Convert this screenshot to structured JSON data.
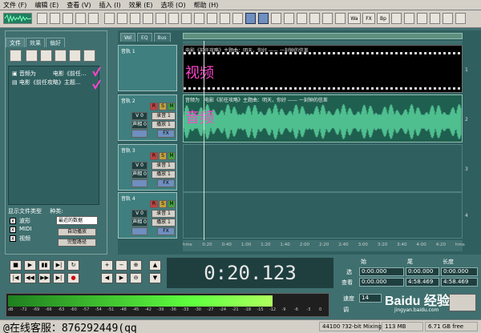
{
  "menu": [
    "文件 (F)",
    "编辑 (E)",
    "查看 (V)",
    "插入 (I)",
    "效果 (E)",
    "选项 (O)",
    "帮助 (H)"
  ],
  "left_tabs": [
    "文件",
    "效果",
    "偏好"
  ],
  "files": [
    "音频为　　　电影《前任...",
    "电影《前任攻略》主题..."
  ],
  "show_types_label": "显示文件类型",
  "sort_label": "种类:",
  "types": [
    "波形",
    "MIDI",
    "视频"
  ],
  "sort_value": "最近的数据",
  "auto_play": "自动播放",
  "full_path": "完整路径",
  "panel_tabs": [
    "Vol",
    "EQ",
    "Bus"
  ],
  "tracks": [
    {
      "name": "音轨 1",
      "clip": "电影《前任攻略》主题曲：明天，你好 —— 一刻钟的信差",
      "overlay": "视频",
      "row": "1"
    },
    {
      "name": "音轨 2",
      "clip": "音频为　电影《前任攻略》主题曲：明天，你好 —— 一刻钟的信差",
      "overlay": "音频",
      "row": "2"
    },
    {
      "name": "音轨 3",
      "row": "3"
    },
    {
      "name": "音轨 4",
      "row": "4"
    }
  ],
  "track_controls": {
    "vol": "V 0",
    "pan": "声相 0",
    "rec": "录音 1",
    "play": "播放 1",
    "fx": "FX",
    "r": "R",
    "s": "S",
    "m": "M"
  },
  "timeline_ticks": [
    "hms",
    "0:20",
    "0:40",
    "1:00",
    "1:20",
    "1:40",
    "2:00",
    "2:20",
    "2:40",
    "3:00",
    "3:20",
    "3:40",
    "4:00",
    "4:20",
    "hms"
  ],
  "time_display": "0:20.123",
  "selection": {
    "headers": [
      "始",
      "尾",
      "长度"
    ],
    "row_sel": "选",
    "row_view": "查看",
    "sel_start": "0:00.000",
    "sel_end": "0:00.000",
    "sel_len": "0:00.000",
    "view_start": "0:00.000",
    "view_end": "4:58.469",
    "view_len": "4:58.469"
  },
  "tempo": {
    "label1": "速度",
    "label2": "调",
    "value": "14"
  },
  "meter_ticks": [
    "dB",
    "-72",
    "-69",
    "-66",
    "-63",
    "-60",
    "-57",
    "-54",
    "-51",
    "-48",
    "-45",
    "-42",
    "-39",
    "-36",
    "-33",
    "-30",
    "-27",
    "-24",
    "-21",
    "-18",
    "-15",
    "-12",
    "-9",
    "-6",
    "-3",
    "0"
  ],
  "meter_level": 0.83,
  "status": {
    "left": "@在线客服：876292449(qq",
    "format": "44100 ?32-bit Mixing",
    "mem": "113 MB",
    "disk": "6.71 GB free"
  },
  "watermark": "Baidu 经验",
  "watermark_url": "jingyan.baidu.com",
  "colors": {
    "track_bg": "#2f5f5f",
    "video_bg": "#000000",
    "audio_wave": "#4fbf8f",
    "accent_pink": "#ff44cc"
  }
}
